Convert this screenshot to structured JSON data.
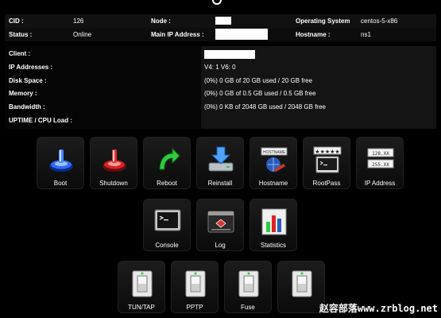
{
  "server": {
    "cid_label": "CID :",
    "cid": "126",
    "node_label": "Node :",
    "os_label": "Operating System",
    "os": "centos-5-x86",
    "status_label": "Status :",
    "status": "Online",
    "main_ip_label": "Main IP Address :",
    "hostname_label": "Hostname :",
    "hostname": "ns1"
  },
  "details": {
    "client_label": "Client :",
    "ip_label": "IP Addresses :",
    "ip": "V4: 1 V6: 0",
    "disk_label": "Disk Space :",
    "disk": "(0%) 0 GB of 20 GB used / 20 GB free",
    "disk_percent": 0,
    "memory_label": "Memory :",
    "memory": "(0%) 0 GB of 0.5 GB used / 0.5 GB free",
    "memory_percent": 0,
    "bandwidth_label": "Bandwidth :",
    "bandwidth": "(0%) 0 KB of 2048 GB used / 2048 GB free",
    "bandwidth_percent": 0,
    "uptime_label": "UPTIME / CPU Load :"
  },
  "actions": {
    "boot": "Boot",
    "shutdown": "Shutdown",
    "reboot": "Reboot",
    "reinstall": "Reinstall",
    "hostname": "Hostname",
    "rootpass": "RootPass",
    "ip_address": "IP Address",
    "console": "Console",
    "log": "Log",
    "statistics": "Statistics",
    "tuntap": "TUN/TAP",
    "pptp": "PPTP",
    "fuse": "Fuse"
  },
  "icon_text": {
    "hostname_sign": "HOSTNAME",
    "password_mask": "★★★★★",
    "ip_line1": "128.XX",
    "ip_line2": "255.XX"
  },
  "watermark": "赵容部落www.zrblog.net"
}
